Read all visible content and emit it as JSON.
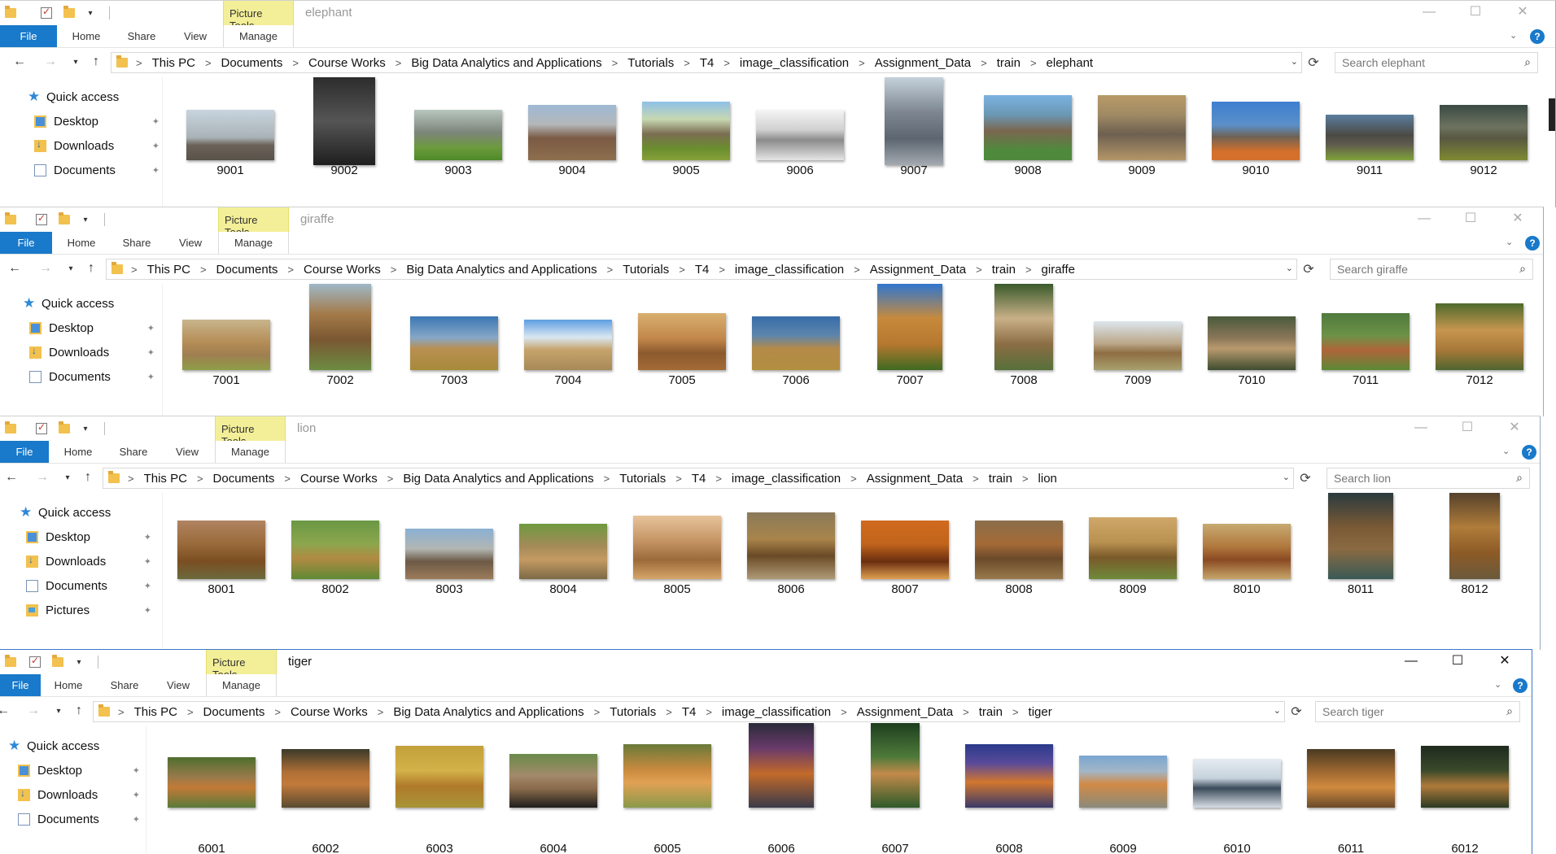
{
  "windows": [
    {
      "id": "elephant",
      "title": "elephant",
      "picture_tools": "Picture Tools",
      "tabs": {
        "file": "File",
        "home": "Home",
        "share": "Share",
        "view": "View",
        "manage": "Manage"
      },
      "breadcrumb": [
        "This PC",
        "Documents",
        "Course Works",
        "Big Data Analytics and Applications",
        "Tutorials",
        "T4",
        "image_classification",
        "Assignment_Data",
        "train",
        "elephant"
      ],
      "search_placeholder": "Search elephant",
      "nav": [
        {
          "label": "Quick access",
          "icon": "star-icon"
        },
        {
          "label": "Desktop",
          "icon": "desktop-icon"
        },
        {
          "label": "Downloads",
          "icon": "downloads-icon"
        },
        {
          "label": "Documents",
          "icon": "documents-icon"
        }
      ],
      "files": [
        "9001",
        "9002",
        "9003",
        "9004",
        "9005",
        "9006",
        "9007",
        "9008",
        "9009",
        "9010",
        "9011",
        "9012"
      ]
    },
    {
      "id": "giraffe",
      "title": "giraffe",
      "picture_tools": "Picture Tools",
      "tabs": {
        "file": "File",
        "home": "Home",
        "share": "Share",
        "view": "View",
        "manage": "Manage"
      },
      "breadcrumb": [
        "This PC",
        "Documents",
        "Course Works",
        "Big Data Analytics and Applications",
        "Tutorials",
        "T4",
        "image_classification",
        "Assignment_Data",
        "train",
        "giraffe"
      ],
      "search_placeholder": "Search giraffe",
      "nav": [
        {
          "label": "Quick access",
          "icon": "star-icon"
        },
        {
          "label": "Desktop",
          "icon": "desktop-icon"
        },
        {
          "label": "Downloads",
          "icon": "downloads-icon"
        },
        {
          "label": "Documents",
          "icon": "documents-icon"
        }
      ],
      "files": [
        "7001",
        "7002",
        "7003",
        "7004",
        "7005",
        "7006",
        "7007",
        "7008",
        "7009",
        "7010",
        "7011",
        "7012"
      ]
    },
    {
      "id": "lion",
      "title": "lion",
      "picture_tools": "Picture Tools",
      "tabs": {
        "file": "File",
        "home": "Home",
        "share": "Share",
        "view": "View",
        "manage": "Manage"
      },
      "breadcrumb": [
        "This PC",
        "Documents",
        "Course Works",
        "Big Data Analytics and Applications",
        "Tutorials",
        "T4",
        "image_classification",
        "Assignment_Data",
        "train",
        "lion"
      ],
      "search_placeholder": "Search lion",
      "nav": [
        {
          "label": "Quick access",
          "icon": "star-icon"
        },
        {
          "label": "Desktop",
          "icon": "desktop-icon"
        },
        {
          "label": "Downloads",
          "icon": "downloads-icon"
        },
        {
          "label": "Documents",
          "icon": "documents-icon"
        },
        {
          "label": "Pictures",
          "icon": "pictures-icon"
        }
      ],
      "files": [
        "8001",
        "8002",
        "8003",
        "8004",
        "8005",
        "8006",
        "8007",
        "8008",
        "8009",
        "8010",
        "8011",
        "8012"
      ]
    },
    {
      "id": "tiger",
      "title": "tiger",
      "picture_tools": "Picture Tools",
      "tabs": {
        "file": "File",
        "home": "Home",
        "share": "Share",
        "view": "View",
        "manage": "Manage"
      },
      "breadcrumb": [
        "This PC",
        "Documents",
        "Course Works",
        "Big Data Analytics and Applications",
        "Tutorials",
        "T4",
        "image_classification",
        "Assignment_Data",
        "train",
        "tiger"
      ],
      "search_placeholder": "Search tiger",
      "nav": [
        {
          "label": "Quick access",
          "icon": "star-icon"
        },
        {
          "label": "Desktop",
          "icon": "desktop-icon"
        },
        {
          "label": "Downloads",
          "icon": "downloads-icon"
        },
        {
          "label": "Documents",
          "icon": "documents-icon"
        }
      ],
      "files": [
        "6001",
        "6002",
        "6003",
        "6004",
        "6005",
        "6006",
        "6007",
        "6008",
        "6009",
        "6010",
        "6011",
        "6012"
      ]
    }
  ],
  "icons": {
    "back": "←",
    "forward": "→",
    "recent": "⌄",
    "up": "↑",
    "refresh": "⟳",
    "search": "⌕",
    "minimize": "—",
    "maximize": "☐",
    "close": "✕",
    "help": "?",
    "ribbon_toggle": "⌄",
    "pin": "📌"
  },
  "colors": {
    "file_tab": "#1979ca",
    "picture_tools": "#f3ef98",
    "active_border": "#3c78c8"
  }
}
